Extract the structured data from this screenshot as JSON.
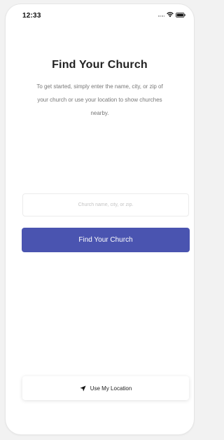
{
  "status_bar": {
    "time": "12:33",
    "icons": [
      "signal-icon",
      "wifi-icon",
      "battery-icon"
    ]
  },
  "header": {
    "title": "Find Your Church",
    "subtitle": "To get started, simply enter the name, city, or zip of your church or use your location to show churches nearby."
  },
  "search": {
    "placeholder": "Church name, city, or zip.",
    "value": ""
  },
  "actions": {
    "find_label": "Find Your Church",
    "location_label": "Use My Location",
    "location_icon": "location-arrow-icon"
  },
  "colors": {
    "primary": "#4a54b0",
    "title": "#222222",
    "subtitle": "#777777"
  }
}
